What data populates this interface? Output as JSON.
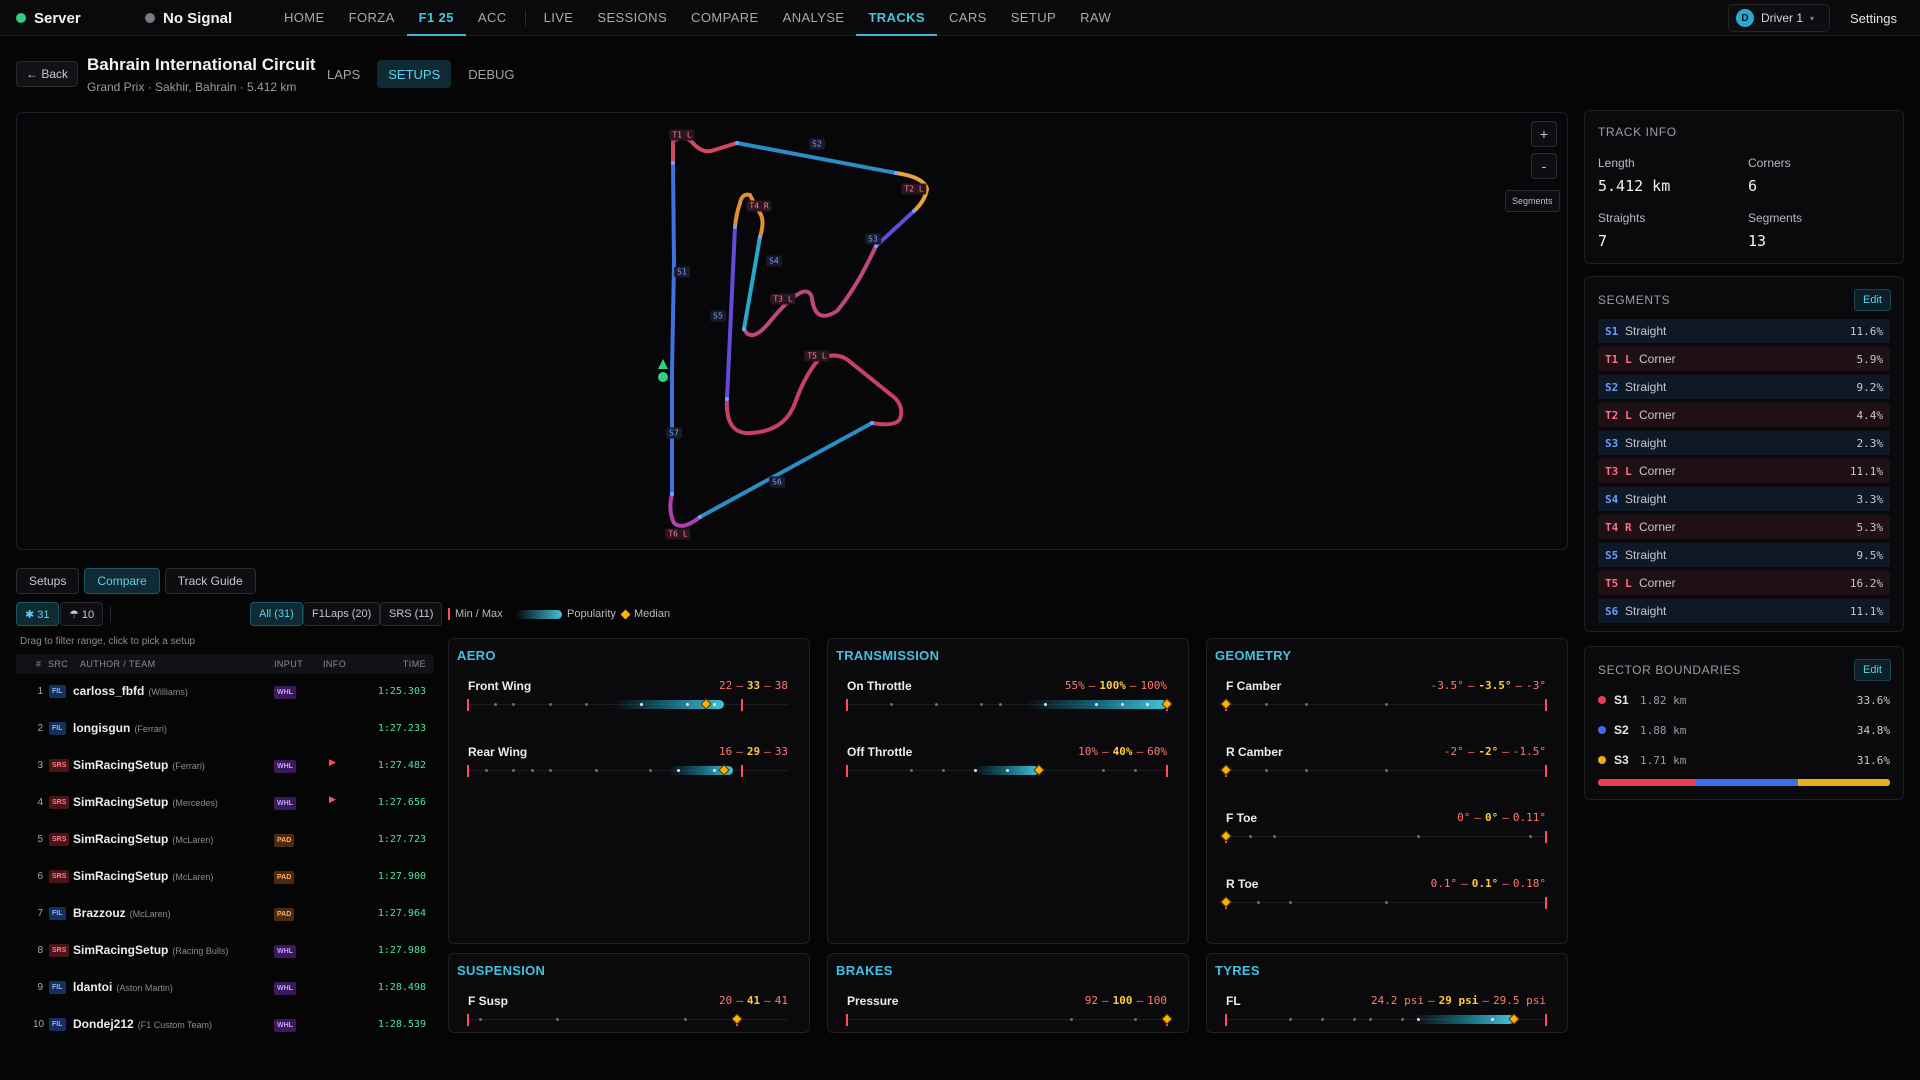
{
  "app": {
    "server": "Server",
    "signal": "No Signal"
  },
  "nav": [
    "HOME",
    "FORZA",
    "F1 25",
    "ACC",
    "LIVE",
    "SESSIONS",
    "COMPARE",
    "ANALYSE",
    "TRACKS",
    "CARS",
    "SETUP",
    "RAW"
  ],
  "driver": {
    "initial": "D",
    "name": "Driver 1"
  },
  "settings": "Settings",
  "page": {
    "back": "← Back",
    "title": "Bahrain International Circuit",
    "subtitle": "Grand Prix · Sakhir, Bahrain · 5.412 km",
    "tabs": [
      "LAPS",
      "SETUPS",
      "DEBUG"
    ]
  },
  "map": {
    "zoom_in": "+",
    "zoom_out": "-",
    "segments_btn": "Segments",
    "labels": [
      "T1 L",
      "S2",
      "T2 L",
      "S3",
      "T4 R",
      "S4",
      "T3 L",
      "S1",
      "S5",
      "T5 L",
      "S7",
      "S6",
      "T6 L"
    ]
  },
  "track_info": {
    "title": "TRACK INFO",
    "length_label": "Length",
    "length": "5.412 km",
    "corners_label": "Corners",
    "corners": "6",
    "straights_label": "Straights",
    "straights": "7",
    "segments_label": "Segments",
    "segments": "13"
  },
  "segments": {
    "title": "SEGMENTS",
    "edit": "Edit",
    "rows": [
      {
        "id": "S1",
        "dir": "",
        "type": "Straight",
        "pct": "11.6%"
      },
      {
        "id": "T1",
        "dir": "L",
        "type": "Corner",
        "pct": "5.9%"
      },
      {
        "id": "S2",
        "dir": "",
        "type": "Straight",
        "pct": "9.2%"
      },
      {
        "id": "T2",
        "dir": "L",
        "type": "Corner",
        "pct": "4.4%"
      },
      {
        "id": "S3",
        "dir": "",
        "type": "Straight",
        "pct": "2.3%"
      },
      {
        "id": "T3",
        "dir": "L",
        "type": "Corner",
        "pct": "11.1%"
      },
      {
        "id": "S4",
        "dir": "",
        "type": "Straight",
        "pct": "3.3%"
      },
      {
        "id": "T4",
        "dir": "R",
        "type": "Corner",
        "pct": "5.3%"
      },
      {
        "id": "S5",
        "dir": "",
        "type": "Straight",
        "pct": "9.5%"
      },
      {
        "id": "T5",
        "dir": "L",
        "type": "Corner",
        "pct": "16.2%"
      },
      {
        "id": "S6",
        "dir": "",
        "type": "Straight",
        "pct": "11.1%"
      }
    ]
  },
  "sectors": {
    "title": "SECTOR BOUNDARIES",
    "edit": "Edit",
    "rows": [
      {
        "id": "S1",
        "km": "1.82 km",
        "pct": "33.6%",
        "color": "#e8404e",
        "share": 33.6
      },
      {
        "id": "S2",
        "km": "1.88 km",
        "pct": "34.8%",
        "color": "#3a6fe8",
        "share": 34.8
      },
      {
        "id": "S3",
        "km": "1.71 km",
        "pct": "31.6%",
        "color": "#e8b020",
        "share": 31.6
      }
    ]
  },
  "bottom_tabs": [
    "Setups",
    "Compare",
    "Track Guide"
  ],
  "filters": {
    "count_a": "✱ 31",
    "count_b": "☂ 10",
    "all": "All (31)",
    "f1laps": "F1Laps (20)",
    "srs": "SRS (11)",
    "legend_minmax": "Min / Max",
    "legend_pop": "Popularity",
    "legend_median": "Median"
  },
  "hint": "Drag to filter range, click to pick a setup",
  "table": {
    "headers": [
      "#",
      "SRC",
      "AUTHOR / TEAM",
      "INPUT",
      "INFO",
      "TIME"
    ],
    "rows": [
      {
        "n": "1",
        "src": "FIL",
        "author": "carloss_fbfd",
        "team": "(Williams)",
        "input": "WHL",
        "flag": false,
        "time": "1:25.303"
      },
      {
        "n": "2",
        "src": "FIL",
        "author": "longisgun",
        "team": "(Ferrari)",
        "input": "",
        "flag": false,
        "time": "1:27.233"
      },
      {
        "n": "3",
        "src": "SRS",
        "author": "SimRacingSetup",
        "team": "(Ferrari)",
        "input": "WHL",
        "flag": true,
        "time": "1:27.482"
      },
      {
        "n": "4",
        "src": "SRS",
        "author": "SimRacingSetup",
        "team": "(Mercedes)",
        "input": "WHL",
        "flag": true,
        "time": "1:27.656"
      },
      {
        "n": "5",
        "src": "SRS",
        "author": "SimRacingSetup",
        "team": "(McLaren)",
        "input": "PAD",
        "flag": false,
        "time": "1:27.723"
      },
      {
        "n": "6",
        "src": "SRS",
        "author": "SimRacingSetup",
        "team": "(McLaren)",
        "input": "PAD",
        "flag": false,
        "time": "1:27.900"
      },
      {
        "n": "7",
        "src": "FIL",
        "author": "Brazzouz",
        "team": "(McLaren)",
        "input": "PAD",
        "flag": false,
        "time": "1:27.964"
      },
      {
        "n": "8",
        "src": "SRS",
        "author": "SimRacingSetup",
        "team": "(Racing Bulls)",
        "input": "WHL",
        "flag": false,
        "time": "1:27.988"
      },
      {
        "n": "9",
        "src": "FIL",
        "author": "ldantoi",
        "team": "(Aston Martin)",
        "input": "WHL",
        "flag": false,
        "time": "1:28.498"
      },
      {
        "n": "10",
        "src": "FIL",
        "author": "Dondej212",
        "team": "(F1 Custom Team)",
        "input": "WHL",
        "flag": false,
        "time": "1:28.539"
      }
    ]
  },
  "panels": [
    {
      "title": "AERO",
      "params": [
        {
          "name": "Front Wing",
          "min": "22",
          "med": "33",
          "max": "38",
          "r": [
            10,
            45
          ],
          "minv": 10,
          "maxv": 40,
          "medv": 36,
          "pop": [
            26,
            38
          ],
          "dots": [
            13,
            15,
            19,
            23,
            29,
            34,
            37
          ]
        },
        {
          "name": "Rear Wing",
          "min": "16",
          "med": "29",
          "max": "33",
          "r": [
            10,
            45
          ],
          "minv": 10,
          "maxv": 40,
          "medv": 38,
          "pop": [
            32,
            39
          ],
          "dots": [
            12,
            15,
            17,
            19,
            24,
            30,
            33,
            37
          ]
        }
      ]
    },
    {
      "title": "TRANSMISSION",
      "params": [
        {
          "name": "On Throttle",
          "min": "55%",
          "med": "100%",
          "max": "100%",
          "r": [
            50,
            100
          ],
          "minv": 50,
          "maxv": 100,
          "medv": 100,
          "pop": [
            78,
            100
          ],
          "dots": [
            57,
            64,
            71,
            74,
            81,
            89,
            93,
            97
          ]
        },
        {
          "name": "Off Throttle",
          "min": "10%",
          "med": "40%",
          "max": "60%",
          "r": [
            0,
            60
          ],
          "minv": 0,
          "maxv": 60,
          "medv": 36,
          "pop": [
            24,
            36
          ],
          "dots": [
            12,
            18,
            24,
            30,
            36,
            48,
            54
          ]
        }
      ]
    },
    {
      "title": "GEOMETRY",
      "params": [
        {
          "name": "F Camber",
          "min": "-3.5°",
          "med": "-3.5°",
          "max": "-3°",
          "r": [
            -3.6,
            -2.8
          ],
          "minv": -3.6,
          "maxv": -2.8,
          "medv": -3.6,
          "pop": [
            -3.6,
            -3.6
          ],
          "dots": [
            -3.5,
            -3.4,
            -3.2
          ]
        },
        {
          "name": "R Camber",
          "min": "-2°",
          "med": "-2°",
          "max": "-1.5°",
          "r": [
            -2.1,
            -1.3
          ],
          "minv": -2.1,
          "maxv": -1.3,
          "medv": -2.1,
          "pop": [
            -2.1,
            -2.1
          ],
          "dots": [
            -2.0,
            -1.9,
            -1.7
          ]
        },
        {
          "name": "F Toe",
          "min": "0°",
          "med": "0°",
          "max": "0.11°",
          "r": [
            0,
            0.2
          ],
          "minv": 0,
          "maxv": 0.2,
          "medv": 0,
          "pop": [
            0,
            0
          ],
          "dots": [
            0.015,
            0.03,
            0.12,
            0.19
          ]
        },
        {
          "name": "R Toe",
          "min": "0.1°",
          "med": "0.1°",
          "max": "0.18°",
          "r": [
            0.1,
            0.3
          ],
          "minv": 0.1,
          "maxv": 0.3,
          "medv": 0.1,
          "pop": [
            0.1,
            0.1
          ],
          "dots": [
            0.12,
            0.14,
            0.2
          ]
        }
      ]
    },
    {
      "title": "SUSPENSION",
      "params": [
        {
          "name": "F Susp",
          "min": "20",
          "med": "41",
          "max": "41",
          "r": [
            20,
            45
          ],
          "minv": 20,
          "maxv": 41,
          "medv": 41,
          "pop": [
            41,
            41
          ],
          "dots": [
            21,
            27,
            37,
            41
          ]
        }
      ]
    },
    {
      "title": "BRAKES",
      "params": [
        {
          "name": "Pressure",
          "min": "92",
          "med": "100",
          "max": "100",
          "r": [
            90,
            100
          ],
          "minv": 90,
          "maxv": 100,
          "medv": 100,
          "pop": [
            100,
            100
          ],
          "dots": [
            97,
            99
          ]
        }
      ]
    },
    {
      "title": "TYRES",
      "params": [
        {
          "name": "FL",
          "min": "24.2 psi",
          "med": "29 psi",
          "max": "29.5 psi",
          "r": [
            24,
            30
          ],
          "minv": 24,
          "maxv": 30,
          "medv": 29.4,
          "pop": [
            27.5,
            29.4
          ],
          "dots": [
            25.2,
            25.8,
            26.4,
            26.7,
            27.3,
            27.6,
            29.0,
            29.4
          ]
        }
      ]
    }
  ]
}
